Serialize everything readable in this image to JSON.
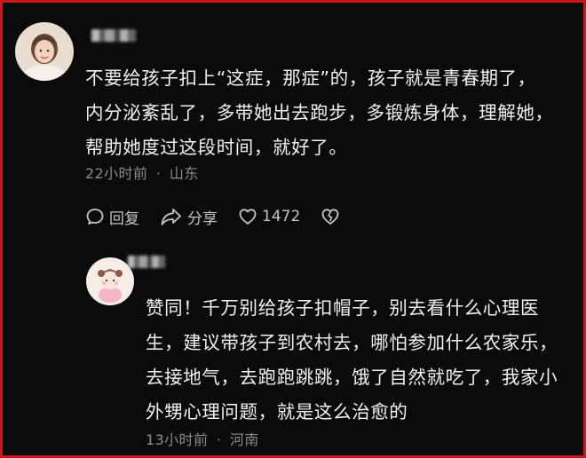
{
  "comment1": {
    "text_lines": [
      "不要给孩子扣上“这症，那症”的，孩子就是青春期了，",
      "内分泌紊乱了，多带她出去跑步，多锻炼身体，理解她，",
      "帮助她度过这段时间，就好了。"
    ],
    "time": "22小时前",
    "separator": "·",
    "location": "山东",
    "actions": {
      "reply_label": "回复",
      "share_label": "分享",
      "like_count": "1472"
    },
    "icons": {
      "reply": "reply-bubble-icon",
      "share": "share-arrow-icon",
      "like": "heart-icon",
      "dislike": "broken-heart-icon"
    }
  },
  "reply1": {
    "text_lines": [
      "赞同！千万别给孩子扣帽子，别去看什么心理医",
      "生，建议带孩子到农村去，哪怕参加什么农家乐，",
      "去接地气，去跑跑跳跳，饿了自然就吃了，我家小",
      "外甥心理问题，就是这么治愈的"
    ],
    "time": "13小时前",
    "separator": "·",
    "location": "河南"
  },
  "colors": {
    "background": "#0b0b0b",
    "frame_border": "#c8161d",
    "text": "#f2f2f2",
    "meta": "#8b8b8b"
  }
}
